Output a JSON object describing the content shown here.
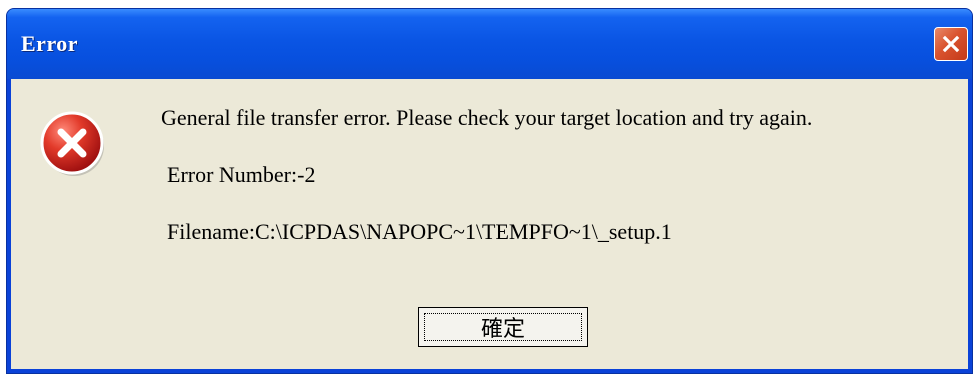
{
  "window": {
    "title": "Error",
    "close_icon": "close-icon"
  },
  "dialog": {
    "icon": "error-icon",
    "message": "General file transfer error. Please check your target location and try again.",
    "error_number": "Error Number:-2",
    "filename": "Filename:C:\\ICPDAS\\NAPOPC~1\\TEMPFO~1\\_setup.1",
    "ok_label": "確定"
  },
  "colors": {
    "titlebar": "#0a55e4",
    "close_button": "#d9532e",
    "dialog_background": "#ece9d8",
    "error_icon": "#d02020"
  }
}
